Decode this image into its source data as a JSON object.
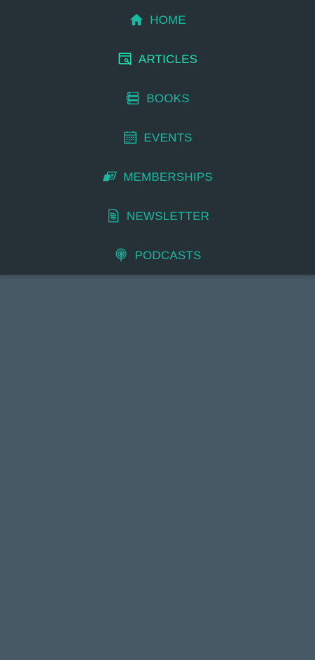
{
  "nav": {
    "items": [
      {
        "label": "HOME",
        "icon": "home-icon",
        "active": false
      },
      {
        "label": "ARTICLES",
        "icon": "article-icon",
        "active": true
      },
      {
        "label": "BOOKS",
        "icon": "books-icon",
        "active": false
      },
      {
        "label": "EVENTS",
        "icon": "calendar-icon",
        "active": false
      },
      {
        "label": "MEMBERSHIPS",
        "icon": "membership-card-icon",
        "active": false
      },
      {
        "label": "NEWSLETTER",
        "icon": "newsletter-icon",
        "active": false
      },
      {
        "label": "PODCASTS",
        "icon": "podcast-icon",
        "active": false
      }
    ]
  },
  "colors": {
    "accent": "#1bb9a1",
    "accent_active": "#20e2b6",
    "nav_background": "#263037",
    "page_background": "#475a65"
  }
}
